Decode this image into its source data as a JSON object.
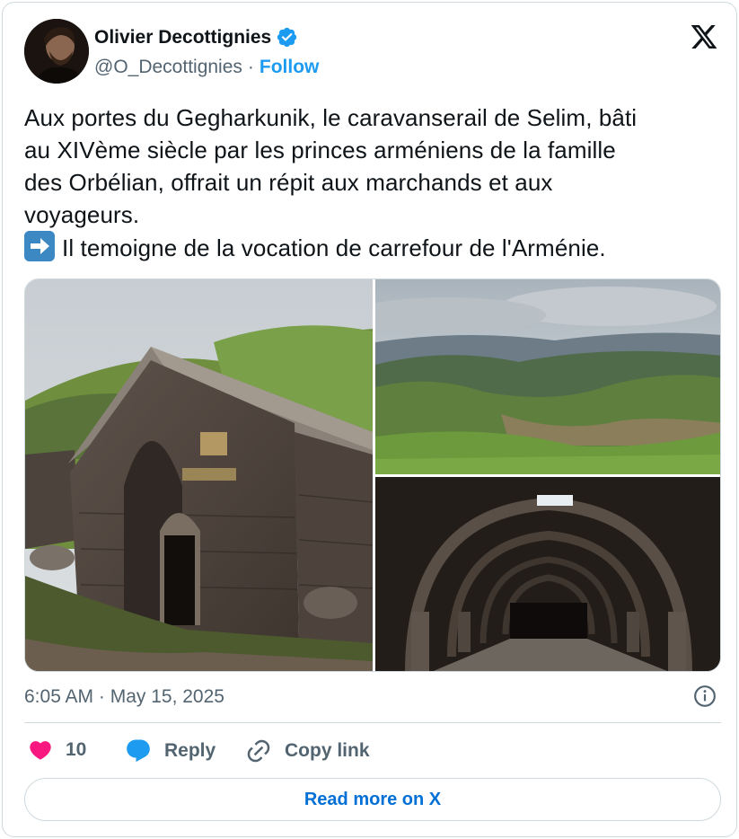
{
  "author": {
    "name": "Olivier Decottignies",
    "handle": "@O_Decottignies",
    "separator": "·",
    "follow_label": "Follow",
    "verified": true
  },
  "tweet": {
    "lines": [
      "Aux portes du Gegharkunik, le caravanserail de Selim, bâti",
      "au XIVème siècle par les princes arméniens de la famille",
      "des Orbélian, offrait un répit aux marchands et aux",
      "voyageurs.",
      "Il temoigne de la vocation de carrefour de l'Arménie."
    ],
    "emoji": "arrow-right-emoji"
  },
  "media": {
    "images": [
      "stone-caravanserai-exterior",
      "green-valley-landscape",
      "vaulted-interior-hall"
    ]
  },
  "meta": {
    "timestamp": "6:05 AM · May 15, 2025"
  },
  "actions": {
    "like_count": "10",
    "reply_label": "Reply",
    "copy_label": "Copy link",
    "read_more_label": "Read more on X"
  },
  "colors": {
    "like": "#f91880",
    "reply": "#1d9bf0",
    "link": "#006fd6",
    "verified": "#1d9bf0",
    "muted": "#536471"
  }
}
